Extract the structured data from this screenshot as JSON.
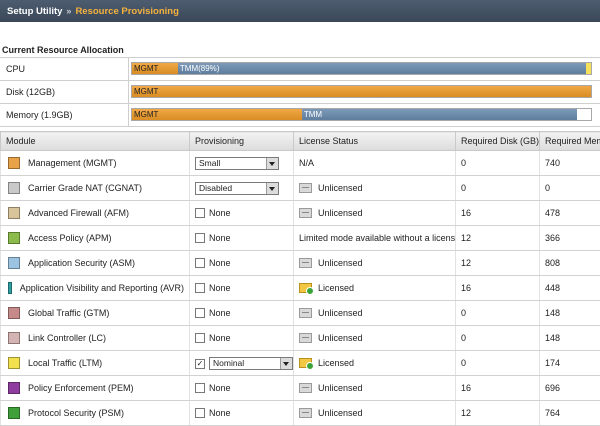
{
  "breadcrumb": {
    "root": "Setup Utility",
    "separator": "»",
    "current": "Resource Provisioning"
  },
  "allocation": {
    "title": "Current Resource Allocation",
    "rows": [
      {
        "label": "CPU",
        "segments": [
          {
            "text": "MGMT",
            "kind": "mgmt",
            "fraction": 0.1
          },
          {
            "text": "TMM(89%)",
            "kind": "tmm",
            "fraction": 0.89
          },
          {
            "text": "",
            "kind": "ltm",
            "fraction": 0.01
          }
        ]
      },
      {
        "label": "Disk (12GB)",
        "segments": [
          {
            "text": "MGMT",
            "kind": "mgmt",
            "fraction": 1.0
          }
        ]
      },
      {
        "label": "Memory (1.9GB)",
        "segments": [
          {
            "text": "MGMT",
            "kind": "mgmt",
            "fraction": 0.37
          },
          {
            "text": "TMM",
            "kind": "tmm",
            "fraction": 0.6
          }
        ]
      }
    ]
  },
  "modules_table": {
    "headers": [
      "Module",
      "Provisioning",
      "License Status",
      "Required Disk (GB)",
      "Required Mem"
    ],
    "rows": [
      {
        "module": "Management (MGMT)",
        "color": "#e8a34a",
        "prov_type": "select",
        "prov": "Small",
        "lic_icon": "none",
        "lic": "N/A",
        "disk": "0",
        "mem": "740"
      },
      {
        "module": "Carrier Grade NAT (CGNAT)",
        "color": "#c9c9c9",
        "prov_type": "select",
        "prov": "Disabled",
        "lic_icon": "unlicensed-icon",
        "lic": "Unlicensed",
        "disk": "0",
        "mem": "0"
      },
      {
        "module": "Advanced Firewall (AFM)",
        "color": "#d8c49a",
        "prov_type": "checkbox",
        "prov": "None",
        "lic_icon": "unlicensed-icon",
        "lic": "Unlicensed",
        "disk": "16",
        "mem": "478"
      },
      {
        "module": "Access Policy (APM)",
        "color": "#8bbb4a",
        "prov_type": "checkbox",
        "prov": "None",
        "lic_icon": "none",
        "lic": "Limited mode available without a license",
        "disk": "12",
        "mem": "366"
      },
      {
        "module": "Application Security (ASM)",
        "color": "#9cc3e2",
        "prov_type": "checkbox",
        "prov": "None",
        "lic_icon": "unlicensed-icon",
        "lic": "Unlicensed",
        "disk": "12",
        "mem": "808"
      },
      {
        "module": "Application Visibility and Reporting (AVR)",
        "color": "#2fa0a4",
        "prov_type": "checkbox",
        "prov": "None",
        "lic_icon": "licensed-icon",
        "lic": "Licensed",
        "disk": "16",
        "mem": "448"
      },
      {
        "module": "Global Traffic (GTM)",
        "color": "#c78a8a",
        "prov_type": "checkbox",
        "prov": "None",
        "lic_icon": "unlicensed-icon",
        "lic": "Unlicensed",
        "disk": "0",
        "mem": "148"
      },
      {
        "module": "Link Controller (LC)",
        "color": "#d4b3b3",
        "prov_type": "checkbox",
        "prov": "None",
        "lic_icon": "unlicensed-icon",
        "lic": "Unlicensed",
        "disk": "0",
        "mem": "148"
      },
      {
        "module": "Local Traffic (LTM)",
        "color": "#f3e04e",
        "prov_type": "select-checked",
        "prov": "Nominal",
        "lic_icon": "licensed-icon",
        "lic": "Licensed",
        "disk": "0",
        "mem": "174"
      },
      {
        "module": "Policy Enforcement (PEM)",
        "color": "#8e3c9e",
        "prov_type": "checkbox",
        "prov": "None",
        "lic_icon": "unlicensed-icon",
        "lic": "Unlicensed",
        "disk": "16",
        "mem": "696"
      },
      {
        "module": "Protocol Security (PSM)",
        "color": "#3f9f3a",
        "prov_type": "checkbox",
        "prov": "None",
        "lic_icon": "unlicensed-icon",
        "lic": "Unlicensed",
        "disk": "12",
        "mem": "764"
      }
    ]
  }
}
